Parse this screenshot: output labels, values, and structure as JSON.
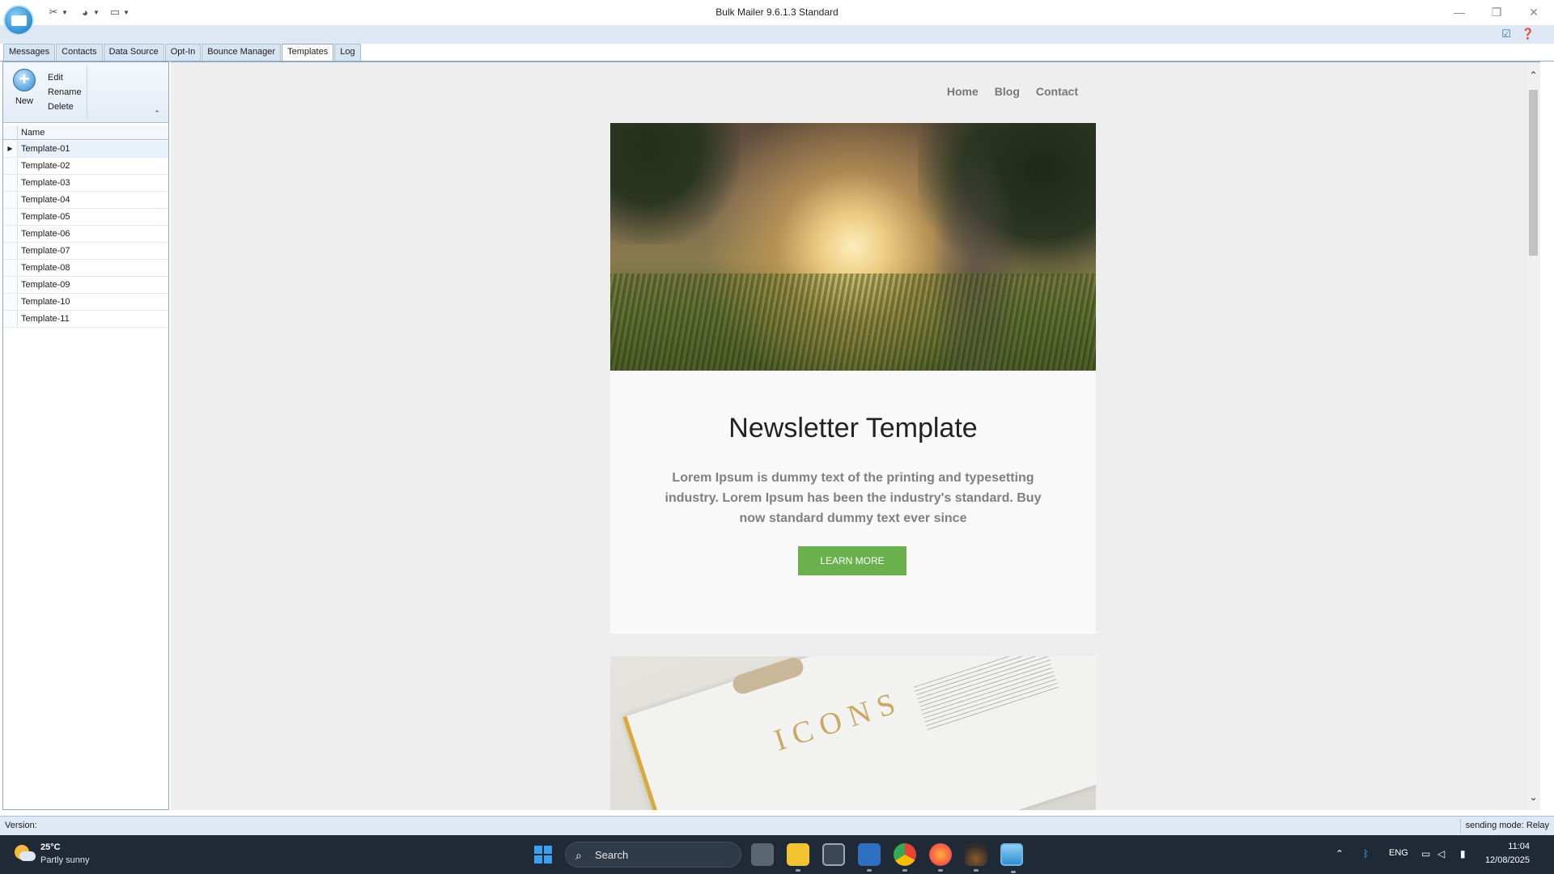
{
  "window": {
    "title": "Bulk Mailer 9.6.1.3 Standard",
    "minimize": "—",
    "restore": "❐",
    "close": "✕"
  },
  "ribbon_tabs": [
    {
      "label": "Messages",
      "active": false
    },
    {
      "label": "Contacts",
      "active": false
    },
    {
      "label": "Data Source",
      "active": false
    },
    {
      "label": "Opt-In",
      "active": false
    },
    {
      "label": "Bounce Manager",
      "active": false
    },
    {
      "label": "Templates",
      "active": true
    },
    {
      "label": "Log",
      "active": false
    }
  ],
  "ribbon_group": {
    "new_label": "New",
    "edit_label": "Edit",
    "rename_label": "Rename",
    "delete_label": "Delete"
  },
  "templates_grid": {
    "column_name": "Name",
    "rows": [
      "Template-01",
      "Template-02",
      "Template-03",
      "Template-04",
      "Template-05",
      "Template-06",
      "Template-07",
      "Template-08",
      "Template-09",
      "Template-10",
      "Template-11"
    ],
    "selected_index": 0
  },
  "preview": {
    "nav": [
      "Home",
      "Blog",
      "Contact"
    ],
    "heading": "Newsletter Template",
    "body": "Lorem Ipsum is dummy text of the printing and typesetting industry. Lorem Ipsum has been the industry's standard. Buy now standard dummy text ever since",
    "button": "LEARN MORE",
    "book_word": "ICONS",
    "button_color": "#6ab04c"
  },
  "statusbar": {
    "version_label": "Version:",
    "sending_mode": "sending mode: Relay"
  },
  "taskbar": {
    "temperature": "25°C",
    "weather": "Partly sunny",
    "search_label": "Search",
    "language": "ENG",
    "time": "11:04",
    "date": "12/08/2025"
  }
}
